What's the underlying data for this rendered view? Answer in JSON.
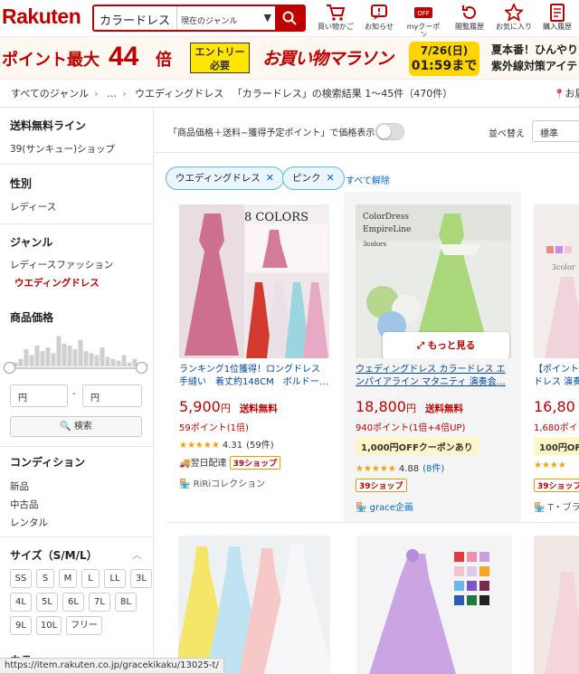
{
  "header": {
    "logo": "Rakuten",
    "search_query": "カラードレス",
    "genre_select": "現在のジャンル",
    "icons": [
      {
        "label": "買い物かご",
        "icon": "cart-icon"
      },
      {
        "label": "お知らせ",
        "icon": "notice-icon"
      },
      {
        "label": "myクーポン",
        "icon": "coupon-icon"
      },
      {
        "label": "閲覧履歴",
        "icon": "history-icon"
      },
      {
        "label": "お気に入り",
        "icon": "star-icon"
      },
      {
        "label": "購入履歴",
        "icon": "receipt-icon"
      }
    ]
  },
  "banner": {
    "point_text": "ポイント最大",
    "multiplier": "44",
    "bai": "倍",
    "entry_line1": "エントリー",
    "entry_line2": "必要",
    "campaign": "お買い物マラソン",
    "date": "7/26(日)",
    "time": "01:59まで",
    "side_line1": "夏本番！ひんやり",
    "side_line2": "紫外線対策アイテ"
  },
  "breadcrumb": {
    "items": [
      "すべてのジャンル",
      "…",
      "ウエディングドレス"
    ],
    "result": "「カラードレス」の検索結果 1〜45件（470件）",
    "right": "お届"
  },
  "sidebar": {
    "shipping_title": "送料無料ライン",
    "shipping_item": "39(サンキュー)ショップ",
    "gender_title": "性別",
    "gender_item": "レディース",
    "genre_title": "ジャンル",
    "genre_parent": "レディースファッション",
    "genre_selected": "ウエディングドレス",
    "price_title": "商品価格",
    "price_min_ph": "円",
    "price_sep": "-",
    "price_max_ph": "円",
    "search_btn": "検索",
    "price_histogram": [
      0.05,
      0.1,
      0.2,
      0.45,
      0.3,
      0.55,
      0.4,
      0.5,
      0.35,
      0.8,
      0.6,
      0.55,
      0.45,
      0.7,
      0.4,
      0.35,
      0.3,
      0.5,
      0.25,
      0.2,
      0.15,
      0.3,
      0.1,
      0.2,
      0.1,
      0.05
    ],
    "condition_title": "コンディション",
    "conditions": [
      "新品",
      "中古品",
      "レンタル"
    ],
    "size_title": "サイズ（S/M/L）",
    "sizes": [
      "SS",
      "S",
      "M",
      "L",
      "LL",
      "3L",
      "4L",
      "5L",
      "6L",
      "7L",
      "8L",
      "9L",
      "10L",
      "フリー"
    ],
    "next_title": "カラー"
  },
  "main": {
    "price_toggle_label": "「商品価格＋送料−獲得予定ポイント」で価格表示",
    "sort_label": "並べ替え",
    "sort_value": "標準",
    "filters": [
      {
        "label": "ウエディングドレス"
      },
      {
        "label": "ピンク"
      }
    ],
    "clear_all": "すべて解除",
    "more_button": "もっと見る"
  },
  "products": [
    {
      "title": "ランキング1位獲得！ロングドレス 手縫い　着丈約148CM　ボルドー…",
      "price": "5,900",
      "yen": "円",
      "ship": "送料無料",
      "points": "59ポイント(1倍)",
      "rating": "4.31",
      "reviews": "(59件)",
      "stars": "★★★★★",
      "delivery": "翌日配達",
      "shop39": "39ショップ",
      "shop": "RiRiコレクション",
      "img_label": "8 COLORS"
    },
    {
      "title": "ウェディングドレス カラードレス エンパイアライン マタニティ 演奏会…",
      "price": "18,800",
      "yen": "円",
      "ship": "送料無料",
      "points": "940ポイント(1倍+4倍UP)",
      "coupon": "1,000円OFFクーポンあり",
      "rating": "4.88",
      "reviews": "(8件)",
      "stars": "★★★★★",
      "shop39": "39ショップ",
      "shop": "grace企画",
      "img_label1": "ColorDress",
      "img_label2": "EmpireLine",
      "img_label3": "3colors"
    },
    {
      "title": "【ポイント ドレス 演奏",
      "price": "16,80",
      "points": "1,680ポイ",
      "coupon": "100円OF",
      "stars": "★★★★",
      "shop39": "39ショップ",
      "shop": "T・ブラ",
      "img_label": "3color"
    }
  ],
  "status_url": "https://item.rakuten.co.jp/gracekikaku/13025-t/",
  "colors": {
    "brand": "#bf0000",
    "link": "#0044aa",
    "tag_border": "#5bb6d8"
  }
}
